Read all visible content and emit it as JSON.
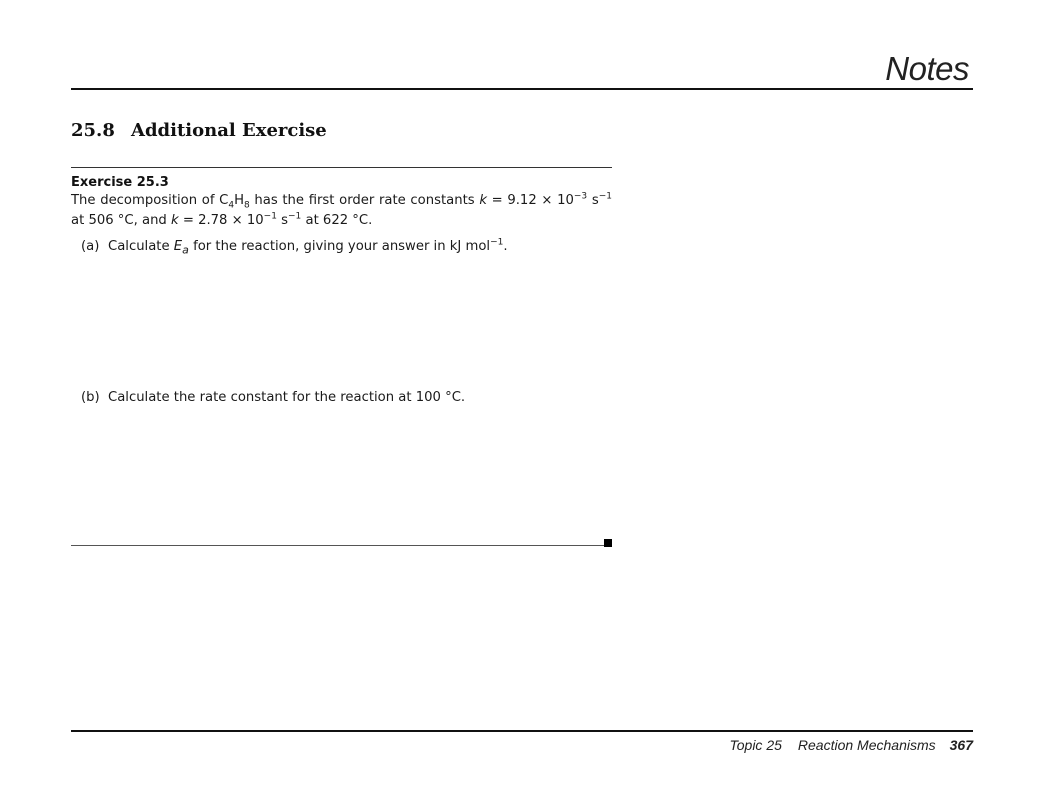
{
  "header": {
    "title": "Notes"
  },
  "section": {
    "number": "25.8",
    "title": "Additional Exercise"
  },
  "exercise": {
    "title": "Exercise 25.3",
    "statement": {
      "t1": "The decomposition of C",
      "sub1": "4",
      "t2": "H",
      "sub2": "8",
      "t3": " has the first order rate constants ",
      "k1": "k",
      "t4": " = 9.12 × 10",
      "exp1": "−3",
      "t5": " s",
      "exp2": "−1",
      "t6": " at 506 °C, and ",
      "k2": "k",
      "t7": " = 2.78 × 10",
      "exp3": "−1",
      "t8": " s",
      "exp4": "−1",
      "t9": " at 622 °C."
    },
    "parts": [
      {
        "label": "(a)",
        "t1": "Calculate ",
        "ea": "E",
        "ea_sub": "a",
        "t2": " for the reaction, giving your answer in kJ mol",
        "exp": "−1",
        "t3": "."
      },
      {
        "label": "(b)",
        "text": "Calculate the rate constant for the reaction at 100 °C."
      }
    ]
  },
  "footer": {
    "topic": "Topic 25",
    "chapter": "Reaction Mechanisms",
    "page": "367"
  }
}
